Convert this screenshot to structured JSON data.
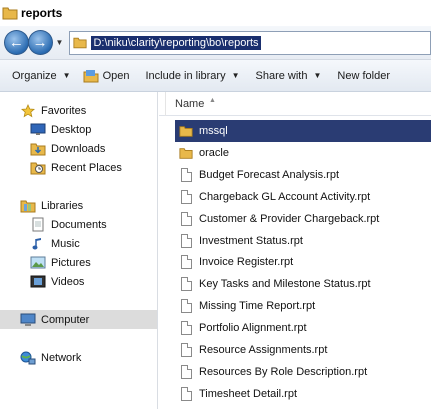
{
  "window": {
    "title": "reports"
  },
  "address": {
    "path": "D:\\niku\\clarity\\reporting\\bo\\reports"
  },
  "toolbar": {
    "organize": "Organize",
    "open": "Open",
    "include_in_library": "Include in library",
    "share_with": "Share with",
    "new_folder": "New folder"
  },
  "nav": {
    "favorites": "Favorites",
    "desktop": "Desktop",
    "downloads": "Downloads",
    "recent_places": "Recent Places",
    "libraries": "Libraries",
    "documents": "Documents",
    "music": "Music",
    "pictures": "Pictures",
    "videos": "Videos",
    "computer": "Computer",
    "network": "Network"
  },
  "content": {
    "column_name": "Name",
    "files": [
      {
        "name": "mssql",
        "type": "folder"
      },
      {
        "name": "oracle",
        "type": "folder"
      },
      {
        "name": "Budget Forecast Analysis.rpt",
        "type": "file"
      },
      {
        "name": "Chargeback GL Account Activity.rpt",
        "type": "file"
      },
      {
        "name": "Customer & Provider Chargeback.rpt",
        "type": "file"
      },
      {
        "name": "Investment Status.rpt",
        "type": "file"
      },
      {
        "name": "Invoice Register.rpt",
        "type": "file"
      },
      {
        "name": "Key Tasks and Milestone Status.rpt",
        "type": "file"
      },
      {
        "name": "Missing Time Report.rpt",
        "type": "file"
      },
      {
        "name": "Portfolio Alignment.rpt",
        "type": "file"
      },
      {
        "name": "Resource Assignments.rpt",
        "type": "file"
      },
      {
        "name": "Resources By Role Description.rpt",
        "type": "file"
      },
      {
        "name": "Timesheet Detail.rpt",
        "type": "file"
      }
    ]
  },
  "colors": {
    "selection": "#2a3c73",
    "folder": "#e8b84a"
  }
}
